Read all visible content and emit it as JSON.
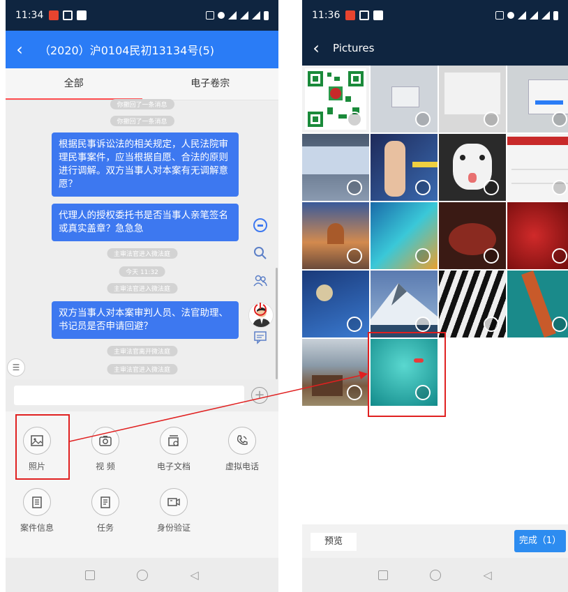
{
  "left": {
    "status": {
      "time": "11:34"
    },
    "title": "（2020）沪0104民初13134号(5)",
    "tabs": [
      "全部",
      "电子卷宗"
    ],
    "messages": {
      "recall1": "你撤回了一条消息",
      "recall2": "你撤回了一条消息",
      "bubble1": "根据民事诉讼法的相关规定，人民法院审理民事案件，应当根据自愿、合法的原则进行调解。双方当事人对本案有无调解意愿？",
      "bubble2": "代理人的授权委托书是否当事人亲笔签名或真实盖章？急急急",
      "sys1": "主审法官进入微法庭",
      "time": "今天 11:32",
      "sys2": "主审法官进入微法庭",
      "bubble3": "双方当事人对本案审判人员、法官助理、书记员是否申请回避？",
      "sys3": "主审法官离开微法庭",
      "sys4": "主审法官进入微法庭"
    },
    "actions": [
      "照片",
      "视 频",
      "电子文档",
      "虚拟电话",
      "案件信息",
      "任务",
      "身份验证"
    ]
  },
  "right": {
    "status": {
      "time": "11:36"
    },
    "title": "Pictures",
    "preview": "预览",
    "done": "完成（1）",
    "photos": [
      {
        "name": "qr",
        "color": "#e8e8e8"
      },
      {
        "name": "screen1",
        "color": "#cfd4da"
      },
      {
        "name": "screen2",
        "color": "#d9d9d9"
      },
      {
        "name": "screen3",
        "color": "#cfd3d6"
      },
      {
        "name": "desk",
        "color": "#5d6f83"
      },
      {
        "name": "anime",
        "color": "#3a4f8c"
      },
      {
        "name": "dog",
        "color": "#2e2e2e"
      },
      {
        "name": "account",
        "color": "#f4f4f4"
      },
      {
        "name": "city",
        "color": "#d37a3e"
      },
      {
        "name": "feather",
        "color": "#2aa0c8"
      },
      {
        "name": "pomegranate",
        "color": "#5a1f16"
      },
      {
        "name": "cherries",
        "color": "#9a1a1a"
      },
      {
        "name": "boat",
        "color": "#2a5a9e"
      },
      {
        "name": "mountain",
        "color": "#4a6e9a"
      },
      {
        "name": "zebra",
        "color": "#7a7a7a"
      },
      {
        "name": "bridge",
        "color": "#1a8a8a"
      },
      {
        "name": "barn",
        "color": "#8a7a6a"
      },
      {
        "name": "sea",
        "color": "#1fb3b0"
      }
    ]
  }
}
